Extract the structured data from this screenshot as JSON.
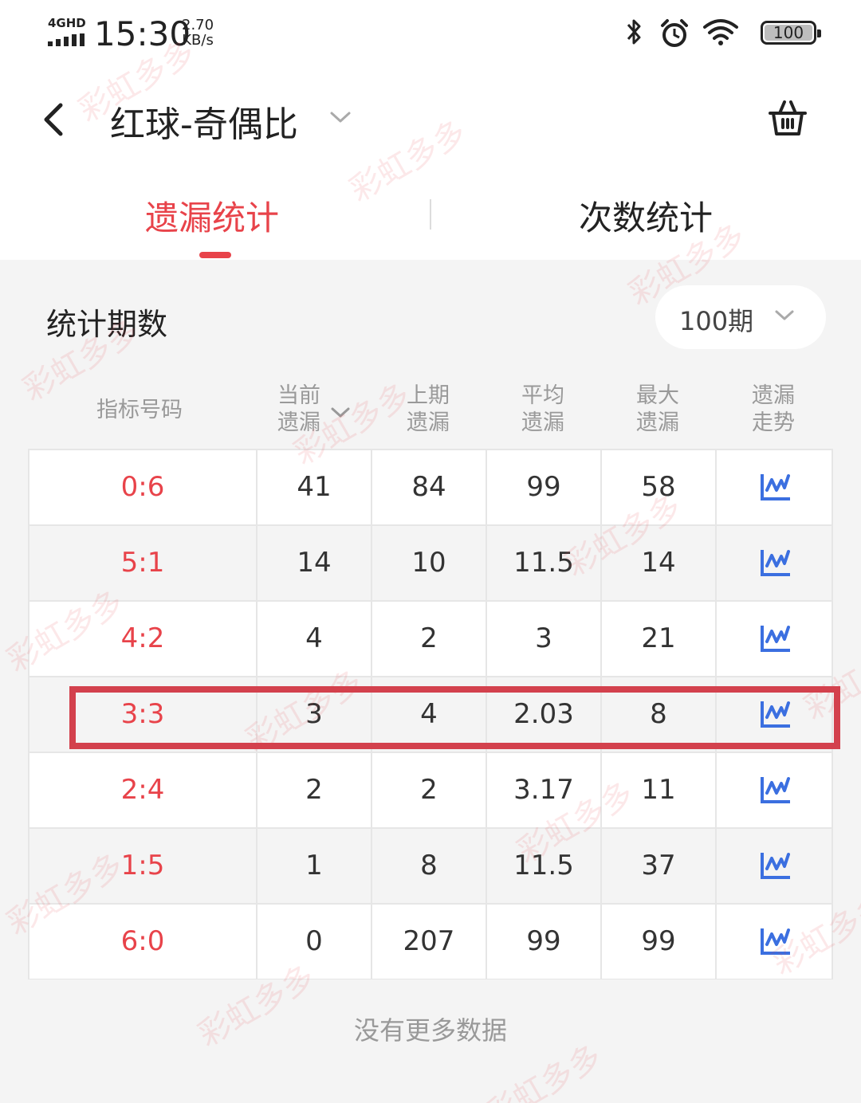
{
  "status_bar": {
    "network": "4GHD",
    "time": "15:30",
    "speed_value": "2.70",
    "speed_unit": "KB/s",
    "battery": "100",
    "icons": [
      "bluetooth-icon",
      "alarm-icon",
      "wifi-icon",
      "battery-icon"
    ]
  },
  "header": {
    "title": "红球-奇偶比",
    "icons": [
      "back-icon",
      "chevron-down-icon",
      "basket-icon"
    ]
  },
  "tabs": [
    {
      "label": "遗漏统计",
      "active": true
    },
    {
      "label": "次数统计",
      "active": false
    }
  ],
  "period": {
    "label": "统计期数",
    "value": "100期"
  },
  "table": {
    "headers": [
      {
        "line1": "指标号码",
        "line2": ""
      },
      {
        "line1": "当前",
        "line2": "遗漏"
      },
      {
        "line1": "上期",
        "line2": "遗漏"
      },
      {
        "line1": "平均",
        "line2": "遗漏"
      },
      {
        "line1": "最大",
        "line2": "遗漏"
      },
      {
        "line1": "遗漏",
        "line2": "走势"
      }
    ],
    "rows": [
      {
        "code": "0:6",
        "current": "41",
        "previous": "84",
        "average": "99",
        "max": "58"
      },
      {
        "code": "5:1",
        "current": "14",
        "previous": "10",
        "average": "11.5",
        "max": "14"
      },
      {
        "code": "4:2",
        "current": "4",
        "previous": "2",
        "average": "3",
        "max": "21"
      },
      {
        "code": "3:3",
        "current": "3",
        "previous": "4",
        "average": "2.03",
        "max": "8"
      },
      {
        "code": "2:4",
        "current": "2",
        "previous": "2",
        "average": "3.17",
        "max": "11"
      },
      {
        "code": "1:5",
        "current": "1",
        "previous": "8",
        "average": "11.5",
        "max": "37"
      },
      {
        "code": "6:0",
        "current": "0",
        "previous": "207",
        "average": "99",
        "max": "99"
      }
    ],
    "trend_icon": "trend-chart-icon",
    "highlighted_row": 3
  },
  "footer": {
    "no_more": "没有更多数据"
  },
  "watermark_text": "彩虹多多",
  "colors": {
    "accent": "#e8434a",
    "highlight_border": "#d3414d",
    "trend_icon": "#3b6fe0",
    "gray_bg": "#f4f4f4"
  }
}
